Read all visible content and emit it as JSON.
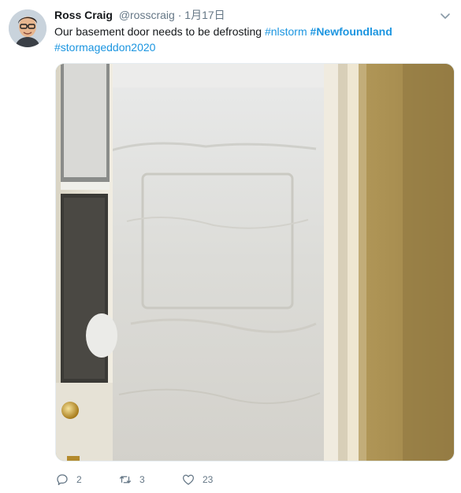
{
  "tweet": {
    "display_name": "Ross Craig",
    "handle": "@rosscraig",
    "separator": "·",
    "timestamp": "1月17日",
    "text_plain": "Our basement door needs to be defrosting ",
    "hashtags": [
      "#nlstorm",
      "#Newfoundland",
      "#stormageddon2020"
    ],
    "counts": {
      "replies": "2",
      "retweets": "3",
      "likes": "23"
    }
  },
  "icons": {
    "avatar": "bitmoji-avatar",
    "caret": "chevron-down-icon",
    "reply": "reply-icon",
    "retweet": "retweet-icon",
    "like": "heart-icon"
  },
  "colors": {
    "link": "#1b95e0",
    "muted": "#657786",
    "text": "#14171a"
  }
}
